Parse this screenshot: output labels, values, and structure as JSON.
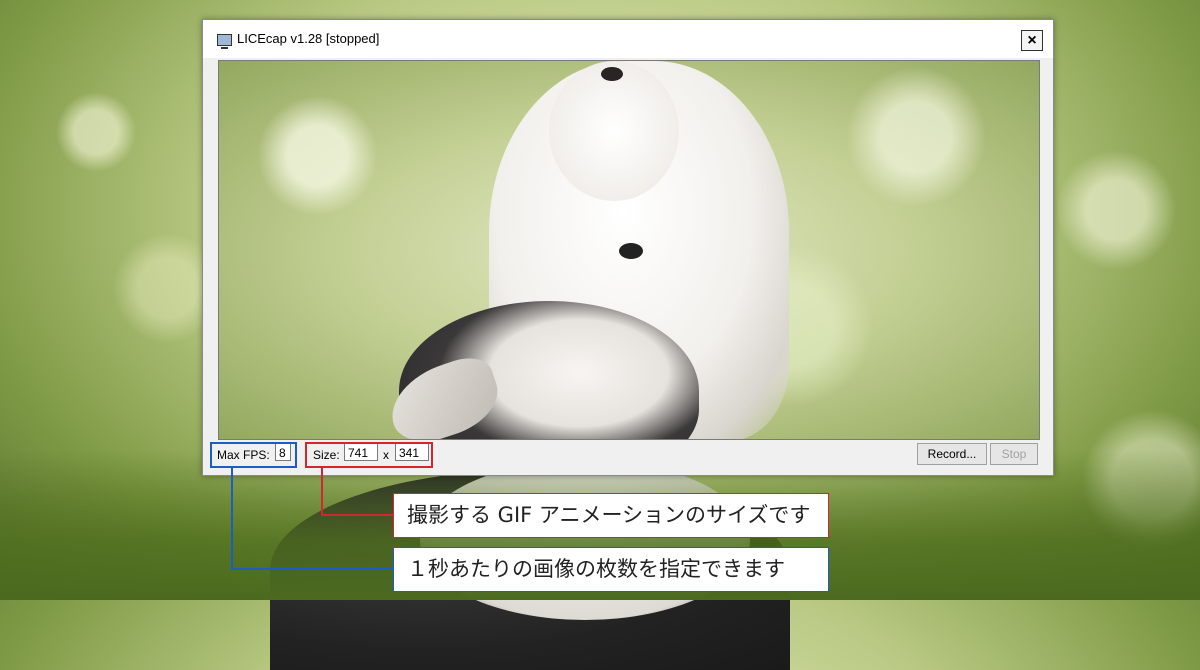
{
  "window": {
    "title": "LICEcap v1.28 [stopped]",
    "close_label": "×"
  },
  "controls": {
    "max_fps_label": "Max FPS:",
    "max_fps_value": "8",
    "size_label": "Size:",
    "width_value": "741",
    "size_separator": "x",
    "height_value": "341",
    "record_label": "Record...",
    "stop_label": "Stop"
  },
  "annotations": {
    "size_callout": "撮影する GIF アニメーションのサイズです",
    "fps_callout": "１秒あたりの画像の枚数を指定できます",
    "size_color": "#d3262e",
    "fps_color": "#1d5cc2"
  }
}
